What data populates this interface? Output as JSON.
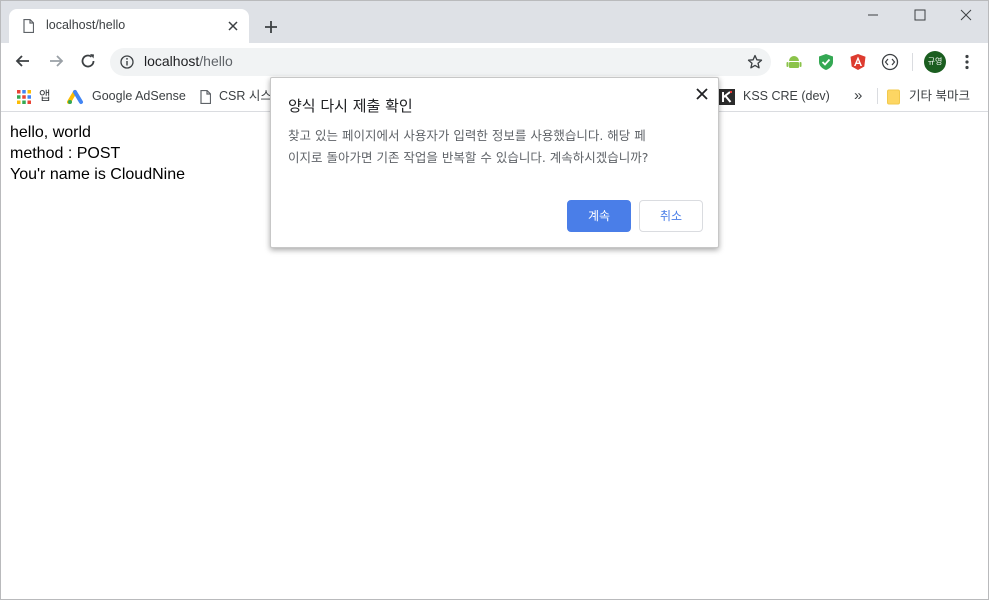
{
  "tab": {
    "title": "localhost/hello"
  },
  "omnibox": {
    "host": "localhost",
    "path": "/hello"
  },
  "profile": {
    "initials": "규영"
  },
  "bookmarks": {
    "apps": "앱",
    "items": [
      "Google AdSense",
      "CSR 시스",
      "KSS CRE (dev)"
    ],
    "overflow": "»",
    "other": "기타 북마크"
  },
  "page": {
    "lines": [
      "hello, world",
      "method : POST",
      "You'r name is CloudNine"
    ]
  },
  "dialog": {
    "title": "양식 다시 제출 확인",
    "body_line1": "찾고 있는 페이지에서 사용자가 입력한 정보를 사용했습니다. 해당 페",
    "body_line2": "이지로 돌아가면 기존 작업을 반복할 수 있습니다. 계속하시겠습니까?",
    "continue_label": "계속",
    "cancel_label": "취소"
  },
  "colors": {
    "primary_button": "#4a7ee8",
    "tabstrip": "#dee1e6",
    "avatar": "#1b5e20"
  }
}
